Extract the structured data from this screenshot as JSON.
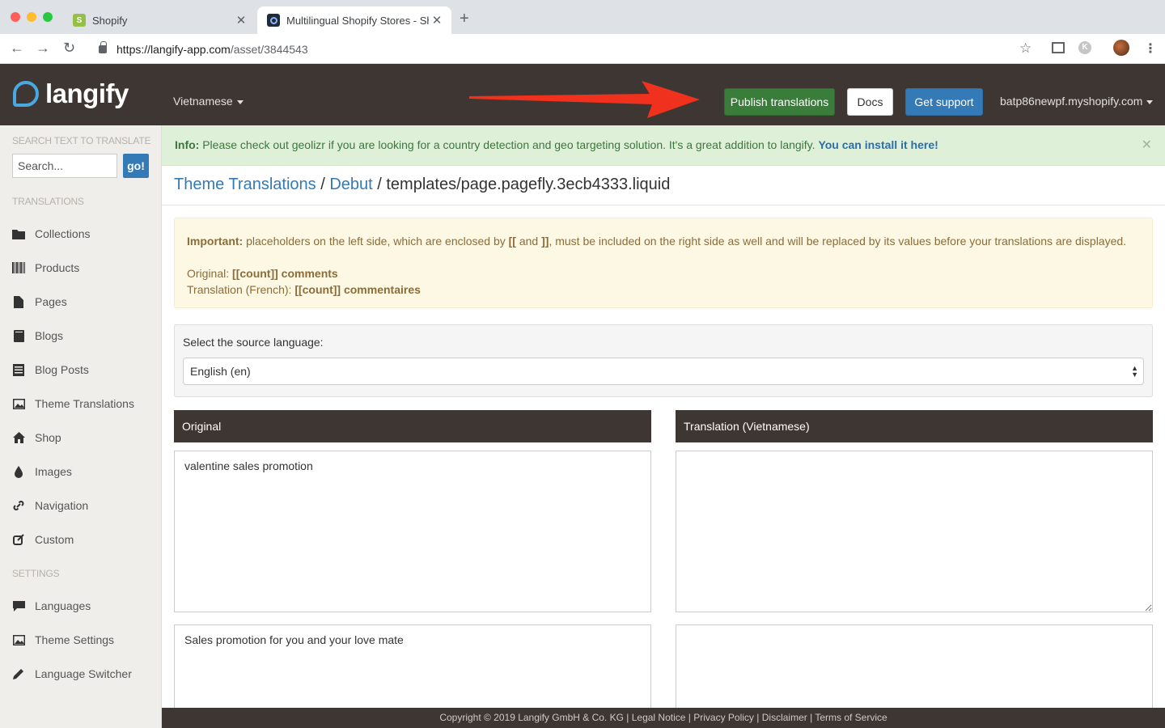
{
  "browser": {
    "tabs": [
      {
        "title": "Shopify",
        "favicon": "shopify-icon"
      },
      {
        "title": "Multilingual Shopify Stores - Sh",
        "favicon": "langify-icon"
      }
    ],
    "url_host": "https://langify-app.com",
    "url_path": "/asset/3844543",
    "profile_initial": "K"
  },
  "header": {
    "logo_text": "langify",
    "language": "Vietnamese",
    "publish_label": "Publish translations",
    "docs_label": "Docs",
    "support_label": "Get support",
    "shop": "batp86newpf.myshopify.com",
    "accent_color": "#4aa8e0"
  },
  "sidebar": {
    "search_heading": "Search text to translate",
    "search_placeholder": "Search...",
    "go_label": "go!",
    "translations_heading": "Translations",
    "settings_heading": "Settings",
    "translation_items": [
      {
        "label": "Collections",
        "icon": "folder-icon"
      },
      {
        "label": "Products",
        "icon": "barcode-icon"
      },
      {
        "label": "Pages",
        "icon": "file-icon"
      },
      {
        "label": "Blogs",
        "icon": "book-icon"
      },
      {
        "label": "Blog Posts",
        "icon": "list-icon"
      },
      {
        "label": "Theme Translations",
        "icon": "picture-icon"
      },
      {
        "label": "Shop",
        "icon": "home-icon"
      },
      {
        "label": "Images",
        "icon": "tint-icon"
      },
      {
        "label": "Navigation",
        "icon": "link-icon"
      },
      {
        "label": "Custom",
        "icon": "edit-icon"
      }
    ],
    "settings_items": [
      {
        "label": "Languages",
        "icon": "comment-icon"
      },
      {
        "label": "Theme Settings",
        "icon": "picture-icon"
      },
      {
        "label": "Language Switcher",
        "icon": "pencil-icon"
      }
    ]
  },
  "info": {
    "prefix": "Info:",
    "text": " Please check out geolizr if you are looking for a country detection and geo targeting solution. It's a great addition to langify. ",
    "link": "You can install it here!"
  },
  "breadcrumb": {
    "item1": "Theme Translations",
    "sep": " / ",
    "item2": "Debut",
    "current": "templates/page.pagefly.3ecb4333.liquid"
  },
  "warning": {
    "prefix": "Important:",
    "text_a": " placeholders on the left side, which are enclosed by ",
    "open": "[[",
    "and": " and ",
    "close": "]]",
    "text_b": ", must be included on the right side as well and will be replaced by its values before your translations are displayed.",
    "original_label": "Original: ",
    "original_value": "[[count]] comments",
    "translation_label": "Translation (French): ",
    "translation_value": "[[count]] commentaires"
  },
  "source": {
    "label": "Select the source language:",
    "selected": "English (en)"
  },
  "columns": {
    "original_header": "Original",
    "translation_header": "Translation (Vietnamese)",
    "rows": [
      {
        "original": "valentine sales promotion",
        "translation": ""
      },
      {
        "original": "Sales promotion for you and your love mate",
        "translation": ""
      }
    ]
  },
  "footer": {
    "copyright": "Copyright © 2019 Langify GmbH & Co. KG",
    "links": [
      "Legal Notice",
      "Privacy Policy",
      "Disclaimer",
      "Terms of Service"
    ]
  }
}
